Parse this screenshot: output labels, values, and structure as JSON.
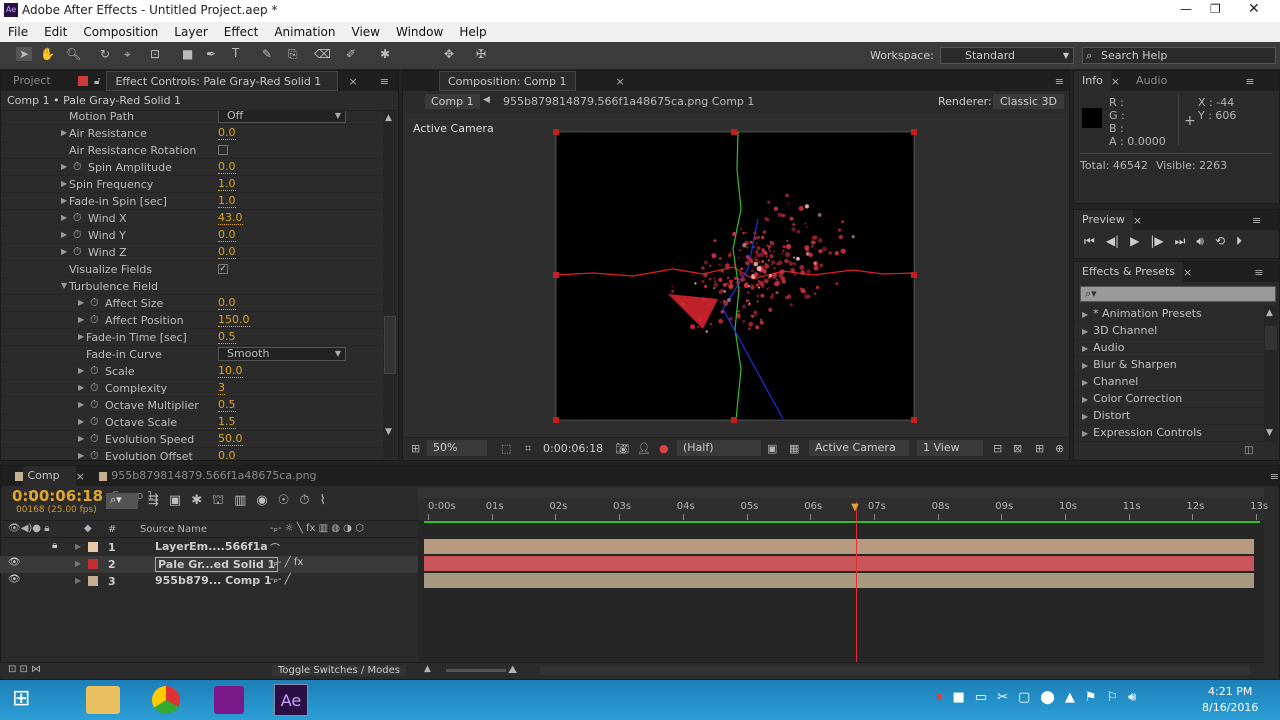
{
  "window": {
    "title": "Adobe After Effects - Untitled Project.aep *",
    "app_icon": "Ae"
  },
  "menu": [
    "File",
    "Edit",
    "Composition",
    "Layer",
    "Effect",
    "Animation",
    "View",
    "Window",
    "Help"
  ],
  "toolbar": {
    "workspace_label": "Workspace:",
    "workspace_value": "Standard",
    "search_placeholder": "Search Help"
  },
  "left_panel": {
    "tab_project": "Project",
    "tab_effect_controls": "Effect Controls: Pale Gray-Red Solid 1",
    "header": "Comp 1 • Pale Gray-Red Solid 1",
    "rows": [
      {
        "label": "Motion Path",
        "indent": 0,
        "twirl": "",
        "stopwatch": false,
        "type": "dropdown",
        "value": "Off"
      },
      {
        "label": "Air Resistance",
        "indent": 0,
        "twirl": "▶",
        "stopwatch": false,
        "type": "number",
        "value": "0.0"
      },
      {
        "label": "Air Resistance Rotation",
        "indent": 0,
        "twirl": "",
        "stopwatch": false,
        "type": "checkbox",
        "value": ""
      },
      {
        "label": "Spin Amplitude",
        "indent": 0,
        "twirl": "▶",
        "stopwatch": true,
        "type": "number",
        "value": "0.0"
      },
      {
        "label": "Spin Frequency",
        "indent": 0,
        "twirl": "▶",
        "stopwatch": false,
        "type": "number",
        "value": "1.0"
      },
      {
        "label": "Fade-in Spin [sec]",
        "indent": 0,
        "twirl": "▶",
        "stopwatch": false,
        "type": "number",
        "value": "1.0"
      },
      {
        "label": "Wind X",
        "indent": 0,
        "twirl": "▶",
        "stopwatch": true,
        "type": "number",
        "value": "43.0"
      },
      {
        "label": "Wind Y",
        "indent": 0,
        "twirl": "▶",
        "stopwatch": true,
        "type": "number",
        "value": "0.0"
      },
      {
        "label": "Wind Z",
        "indent": 0,
        "twirl": "▶",
        "stopwatch": true,
        "type": "number",
        "value": "0.0"
      },
      {
        "label": "Visualize Fields",
        "indent": 0,
        "twirl": "",
        "stopwatch": false,
        "type": "checkbox",
        "value": "✓"
      },
      {
        "label": "Turbulence Field",
        "indent": 0,
        "twirl": "▼",
        "stopwatch": false,
        "type": "group",
        "value": ""
      },
      {
        "label": "Affect Size",
        "indent": 1,
        "twirl": "▶",
        "stopwatch": true,
        "type": "number",
        "value": "0.0"
      },
      {
        "label": "Affect Position",
        "indent": 1,
        "twirl": "▶",
        "stopwatch": true,
        "type": "number",
        "value": "150.0"
      },
      {
        "label": "Fade-in Time [sec]",
        "indent": 1,
        "twirl": "▶",
        "stopwatch": false,
        "type": "number",
        "value": "0.5"
      },
      {
        "label": "Fade-in Curve",
        "indent": 1,
        "twirl": "",
        "stopwatch": false,
        "type": "dropdown",
        "value": "Smooth"
      },
      {
        "label": "Scale",
        "indent": 1,
        "twirl": "▶",
        "stopwatch": true,
        "type": "number",
        "value": "10.0"
      },
      {
        "label": "Complexity",
        "indent": 1,
        "twirl": "▶",
        "stopwatch": true,
        "type": "number",
        "value": "3"
      },
      {
        "label": "Octave Multiplier",
        "indent": 1,
        "twirl": "▶",
        "stopwatch": true,
        "type": "number",
        "value": "0.5"
      },
      {
        "label": "Octave Scale",
        "indent": 1,
        "twirl": "▶",
        "stopwatch": true,
        "type": "number",
        "value": "1.5"
      },
      {
        "label": "Evolution Speed",
        "indent": 1,
        "twirl": "▶",
        "stopwatch": true,
        "type": "number",
        "value": "50.0"
      },
      {
        "label": "Evolution Offset",
        "indent": 1,
        "twirl": "▶",
        "stopwatch": true,
        "type": "number",
        "value": "0.0"
      }
    ]
  },
  "composition": {
    "tab": "Composition: Comp 1",
    "crumb1": "Comp 1",
    "crumb2": "955b879814879.566f1a48675ca.png Comp 1",
    "renderer_label": "Renderer:",
    "renderer": "Classic 3D",
    "camera_label": "Active Camera",
    "footer": {
      "zoom": "50%",
      "timecode": "0:00:06:18",
      "resolution": "(Half)",
      "view": "Active Camera",
      "views": "1 View"
    }
  },
  "info": {
    "tab": "Info",
    "tab2": "Audio",
    "r": "R :",
    "g": "G :",
    "b": "B :",
    "a": "A :  0.0000",
    "x": "X : -44",
    "y": "Y : 606",
    "total": "Total: 46542",
    "visible": "Visible: 2263"
  },
  "preview": {
    "tab": "Preview"
  },
  "effects": {
    "tab": "Effects & Presets",
    "items": [
      "* Animation Presets",
      "3D Channel",
      "Audio",
      "Blur & Sharpen",
      "Channel",
      "Color Correction",
      "Distort",
      "Expression Controls"
    ]
  },
  "timeline": {
    "tab1": "Comp 1",
    "tab2": "955b879814879.566f1a48675ca.png Comp 1",
    "timecode": "0:00:06:18",
    "frames": "00168 (25.00 fps)",
    "col_hash": "#",
    "col_source": "Source Name",
    "playhead_seconds": 6.72,
    "ticks": [
      "0:00s",
      "01s",
      "02s",
      "03s",
      "04s",
      "05s",
      "06s",
      "07s",
      "08s",
      "09s",
      "10s",
      "11s",
      "12s",
      "13s"
    ],
    "layers": [
      {
        "num": "1",
        "name": "LayerEm....566f1a",
        "label_color": "#e8c9a8",
        "bar_color": "#b89a80",
        "eye": false,
        "lock": true
      },
      {
        "num": "2",
        "name": "Pale Gr...ed Solid 1",
        "label_color": "#c03030",
        "bar_color": "#c9565a",
        "eye": true,
        "lock": false,
        "selected": true
      },
      {
        "num": "3",
        "name": "955b879... Comp 1",
        "label_color": "#c4b090",
        "bar_color": "#a89a80",
        "eye": true,
        "lock": false
      }
    ],
    "toggle": "Toggle Switches / Modes"
  },
  "taskbar": {
    "time": "4:21 PM",
    "date": "8/16/2016"
  }
}
